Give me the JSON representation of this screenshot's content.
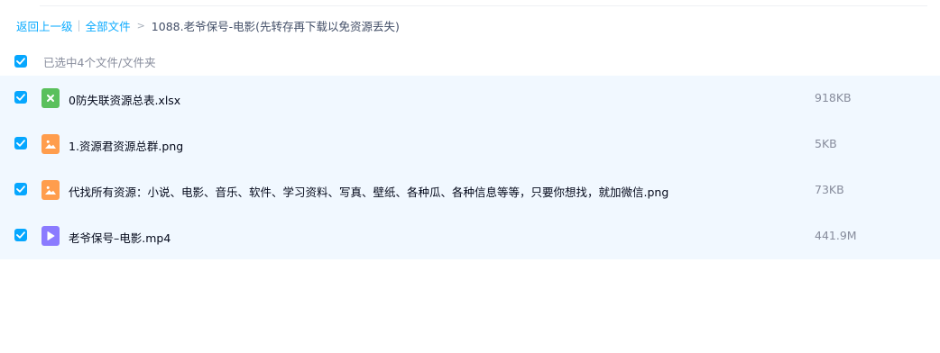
{
  "breadcrumb": {
    "back": "返回上一级",
    "separator": "|",
    "all_files": "全部文件",
    "arrow": ">",
    "current": "1088.老爷保号-电影(先转存再下载以免资源丢失)"
  },
  "selection": {
    "label": "已选中4个文件/文件夹",
    "checked": true
  },
  "colors": {
    "accent": "#06a7ff",
    "row_bg": "#f1f8ff",
    "xlsx_icon": "#5ac05c",
    "image_icon": "#ff9d4d",
    "video_icon": "#8b7bff"
  },
  "files": [
    {
      "name": "0防失联资源总表.xlsx",
      "size": "918KB",
      "icon": "excel-file-icon",
      "checked": true
    },
    {
      "name": "1.资源君资源总群.png",
      "size": "5KB",
      "icon": "image-file-icon",
      "checked": true
    },
    {
      "name": "代找所有资源：小说、电影、音乐、软件、学习资料、写真、壁纸、各种瓜、各种信息等等，只要你想找，就加微信.png",
      "size": "73KB",
      "icon": "image-file-icon",
      "checked": true
    },
    {
      "name": "老爷保号–电影.mp4",
      "size": "441.9M",
      "icon": "video-file-icon",
      "checked": true
    }
  ]
}
